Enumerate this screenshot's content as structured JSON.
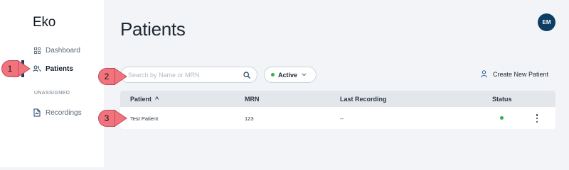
{
  "app": {
    "brand": "Eko"
  },
  "sidebar": {
    "items": [
      {
        "label": "Dashboard",
        "icon": "grid-icon"
      },
      {
        "label": "Patients",
        "icon": "users-icon",
        "active": true
      }
    ],
    "section_label": "UNASSIGNED",
    "section_items": [
      {
        "label": "Recordings",
        "icon": "document-icon"
      }
    ]
  },
  "header": {
    "title": "Patients",
    "avatar_initials": "EM"
  },
  "toolbar": {
    "search_placeholder": "Search by Name or MRN",
    "filter_label": "Active",
    "create_label": "Create New Patient"
  },
  "table": {
    "columns": [
      "Patient",
      "MRN",
      "Last Recording",
      "Status"
    ],
    "sort_indicator": "^",
    "rows": [
      {
        "patient": "Test Patient",
        "mrn": "123",
        "last_recording": "--",
        "status": "active"
      }
    ]
  },
  "annotations": [
    "1",
    "2",
    "3"
  ],
  "colors": {
    "accent": "#0e3d63",
    "status_active": "#2fb24c",
    "callout": "#f1737d"
  }
}
